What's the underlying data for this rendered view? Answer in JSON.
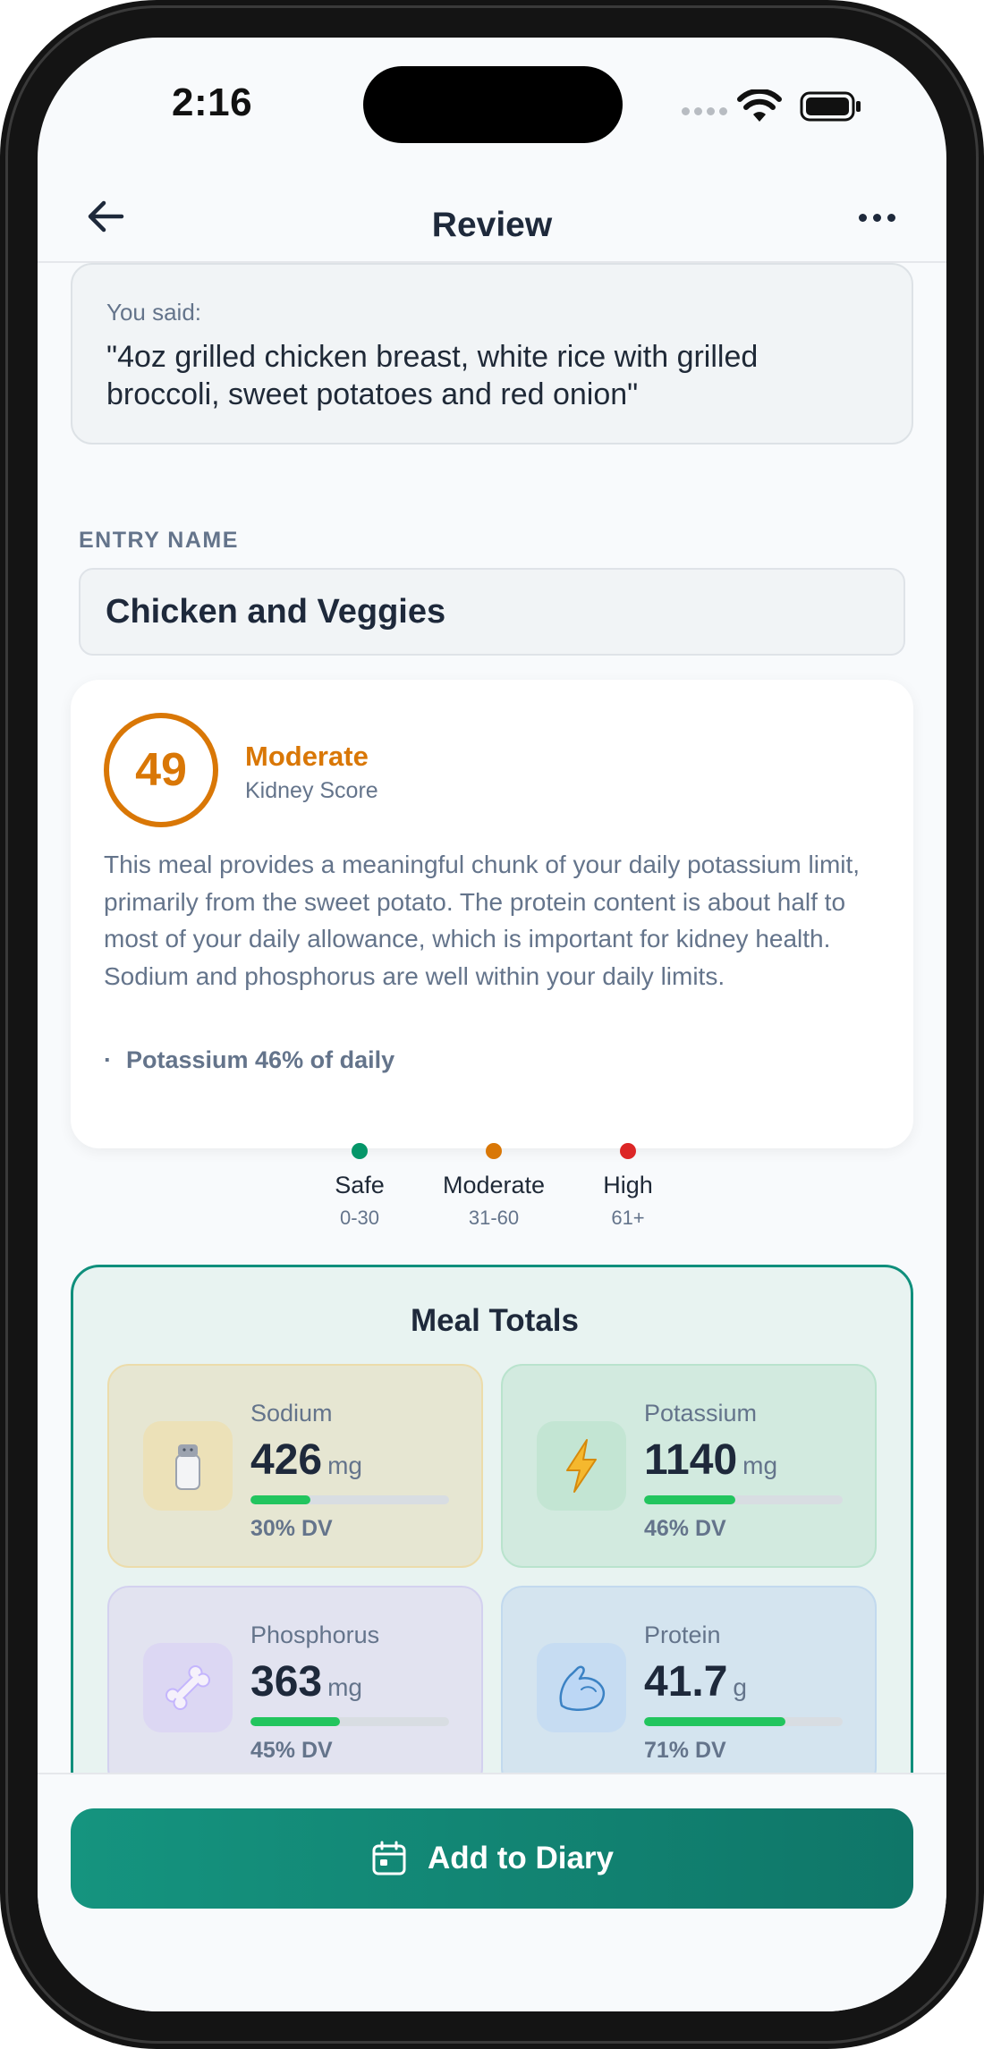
{
  "status_bar": {
    "time": "2:16"
  },
  "header": {
    "title": "Review"
  },
  "transcript": {
    "label": "You said:",
    "text": "\"4oz grilled chicken breast, white rice with grilled broccoli, sweet potatoes and red onion\""
  },
  "entry": {
    "label": "ENTRY NAME",
    "value": "Chicken and Veggies"
  },
  "score": {
    "value": "49",
    "level": "Moderate",
    "subtitle": "Kidney Score",
    "level_color": "#d97706",
    "description": "This meal provides a meaningful chunk of your daily potassium limit, primarily from the sweet potato. The protein content is about half to most of your daily allowance, which is important for kidney health. Sodium and phosphorus are well within your daily limits.",
    "bullet": "Potassium 46% of daily"
  },
  "legend": [
    {
      "label": "Safe",
      "range": "0-30",
      "color": "#059669"
    },
    {
      "label": "Moderate",
      "range": "31-60",
      "color": "#d97706"
    },
    {
      "label": "High",
      "range": "61+",
      "color": "#dc2626"
    }
  ],
  "totals": {
    "title": "Meal Totals",
    "nutrients": [
      {
        "name": "Sodium",
        "value": "426",
        "unit": "mg",
        "dv": "30% DV",
        "dv_fraction": 0.3,
        "icon": "salt-shaker-icon"
      },
      {
        "name": "Potassium",
        "value": "1140",
        "unit": "mg",
        "dv": "46% DV",
        "dv_fraction": 0.46,
        "icon": "lightning-icon"
      },
      {
        "name": "Phosphorus",
        "value": "363",
        "unit": "mg",
        "dv": "45% DV",
        "dv_fraction": 0.45,
        "icon": "bone-icon"
      },
      {
        "name": "Protein",
        "value": "41.7",
        "unit": "g",
        "dv": "71% DV",
        "dv_fraction": 0.71,
        "icon": "flexed-bicep-icon"
      }
    ]
  },
  "actions": {
    "add_label": "Add to Diary"
  }
}
